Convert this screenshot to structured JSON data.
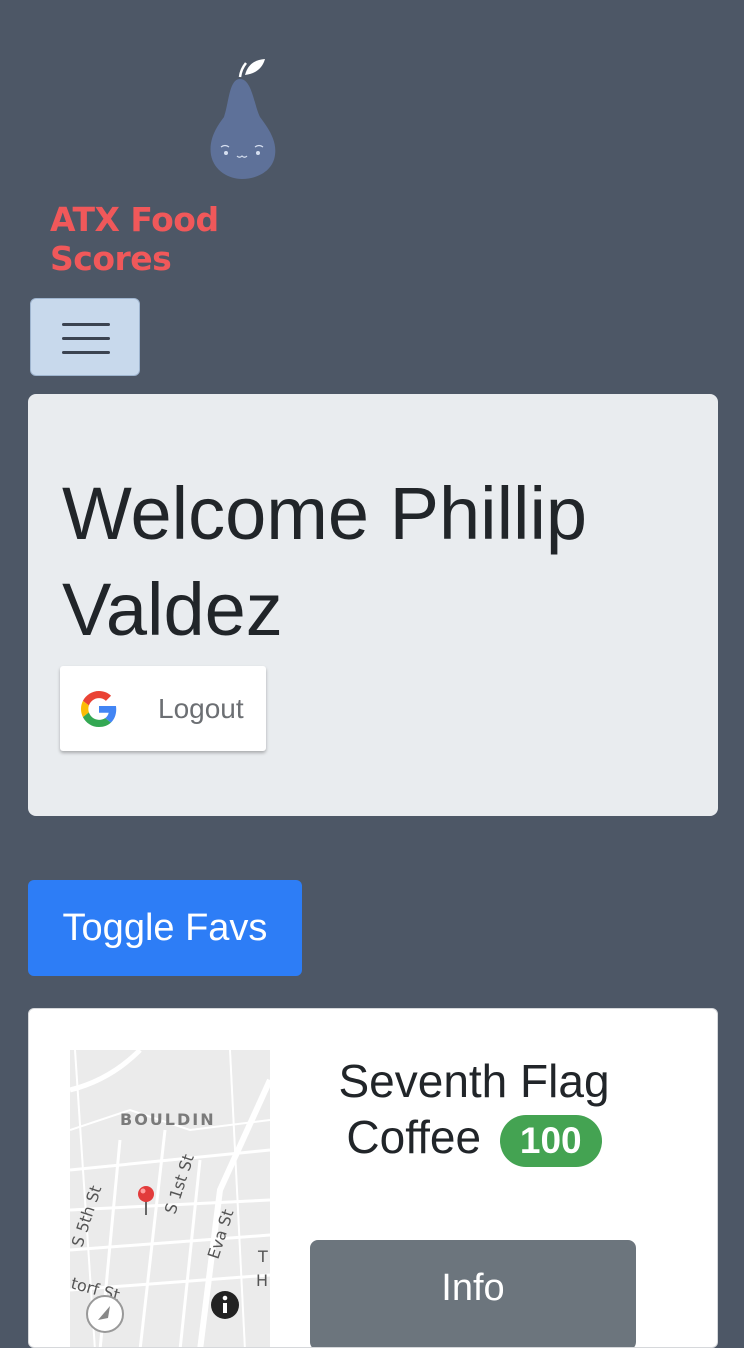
{
  "brand": {
    "name": "ATX Food Scores"
  },
  "nav": {
    "toggler_icon": "hamburger-icon"
  },
  "jumbotron": {
    "welcome": "Welcome Phillip Valdez",
    "logout_label": "Logout",
    "logout_icon": "google-icon"
  },
  "favs": {
    "toggle_label": "Toggle Favs"
  },
  "restaurant": {
    "name": "Seventh Flag Coffee",
    "score": "100",
    "score_color": "#44a352",
    "info_label": "Info",
    "map": {
      "neighborhood": "BOULDIN",
      "streets": [
        "S 5th St",
        "S 1st St",
        "Eva St",
        "torf St"
      ],
      "marker_icon": "map-pin-icon",
      "info_icon": "info-icon",
      "compass_icon": "compass-icon"
    }
  },
  "colors": {
    "background": "#4d5766",
    "brand": "#f0585a",
    "primary": "#2d7df6",
    "secondary": "#6c757d"
  }
}
